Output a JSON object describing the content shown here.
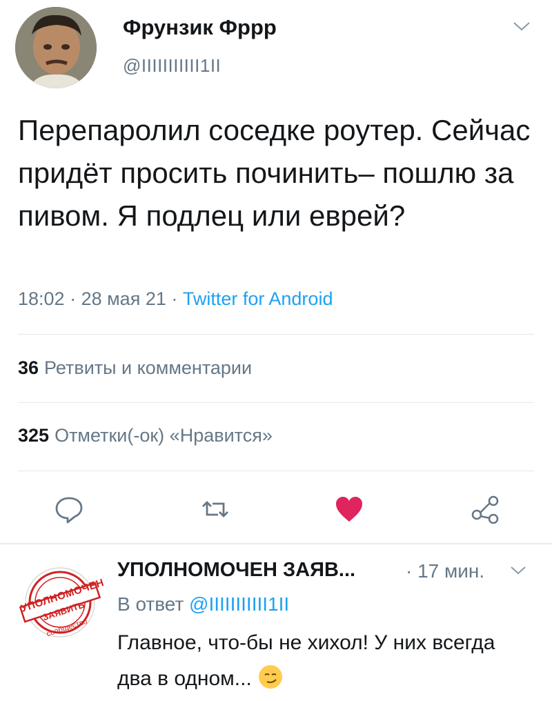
{
  "tweet": {
    "author_name": "Фрунзик Фррр",
    "author_handle": "@IIIIIIIIIII1II",
    "text": "Перепаролил соседке роутер. Сейчас придёт просить починить– пошлю за пивом. Я подлец или еврей?",
    "time": "18:02",
    "date": "28 мая 21",
    "client": "Twitter for Android",
    "separator": " · "
  },
  "stats": {
    "retweets_count": "36",
    "retweets_label": "Ретвиты и комментарии",
    "likes_count": "325",
    "likes_label": "Отметки(-ок) «Нравится»"
  },
  "actions": [
    {
      "name": "reply-icon"
    },
    {
      "name": "retweet-icon"
    },
    {
      "name": "heart-icon",
      "liked": true
    },
    {
      "name": "share-icon"
    }
  ],
  "colors": {
    "accent": "#1da1f2",
    "like": "#e0245e",
    "muted": "#657786",
    "stamp": "#d02020"
  },
  "reply": {
    "author_name": "УПОЛНОМОЧЕН ЗАЯВ...",
    "time": "· 17 мин.",
    "reply_to_label": "В ответ",
    "reply_to_handle": "@IIIIIIIIIII1II",
    "text": "Главное, что-бы не хихол! У них всегда два в одном...",
    "avatar_text_line1": "УПОЛНОМОЧЕН",
    "avatar_text_line2": "ЗАЯВИТЬ",
    "avatar_text_line3": "сообщество"
  }
}
